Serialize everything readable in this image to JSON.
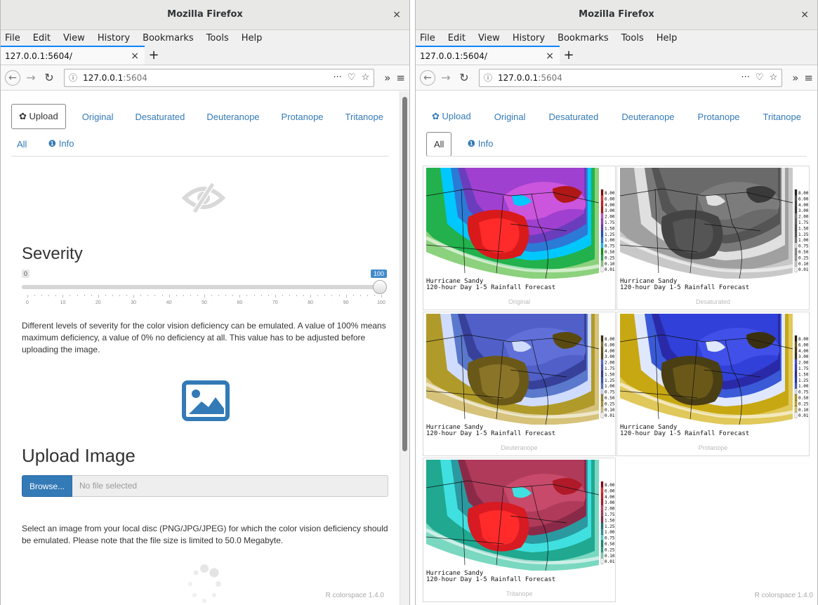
{
  "browser": {
    "window_title": "Mozilla Firefox",
    "close_glyph": "×",
    "menu": [
      "File",
      "Edit",
      "View",
      "History",
      "Bookmarks",
      "Tools",
      "Help"
    ],
    "tab_title": "127.0.0.1:5604/",
    "url_host": "127.0.0.1",
    "url_port": ":5604",
    "url_info_glyph": "ⓘ",
    "url_actions": [
      "···",
      "♡",
      "☆"
    ],
    "overflow_glyph": "»",
    "hamburger_glyph": "≡"
  },
  "app": {
    "nav": [
      {
        "label": "Upload",
        "icon": "gear-icon"
      },
      {
        "label": "Original"
      },
      {
        "label": "Desaturated"
      },
      {
        "label": "Deuteranope"
      },
      {
        "label": "Protanope"
      },
      {
        "label": "Tritanope"
      },
      {
        "label": "All"
      },
      {
        "label": "Info",
        "icon": "info-icon"
      }
    ],
    "footer": "R colorspace 1.4.0"
  },
  "left": {
    "active_tab": "Upload",
    "severity_title": "Severity",
    "slider": {
      "min": 0,
      "max": 100,
      "value": 100,
      "min_label": "0",
      "max_label": "100",
      "tick_labels": [
        "0",
        "10",
        "20",
        "30",
        "40",
        "50",
        "60",
        "70",
        "80",
        "90",
        "100"
      ]
    },
    "severity_text": "Different levels of severity for the color vision deficiency can be emulated. A value of 100% means maximum deficiency, a value of 0% no deficiency at all. This value has to be adjusted before uploading the image.",
    "upload_title": "Upload Image",
    "browse_label": "Browse...",
    "file_placeholder": "No file selected",
    "upload_text": "Select an image from your local disc (PNG/JPG/JPEG) for which the color vision deficiency should be emulated. Please note that the file size is limited to 50.0 Megabyte."
  },
  "right": {
    "active_tab": "All",
    "caption_line1": "Hurricane Sandy",
    "caption_line2": "120-hour Day 1-5 Rainfall Forecast",
    "legend_values": [
      "8.00",
      "6.00",
      "4.00",
      "3.00",
      "2.00",
      "1.75",
      "1.50",
      "1.25",
      "1.00",
      "0.75",
      "0.50",
      "0.25",
      "0.10",
      "0.01"
    ],
    "panels": [
      {
        "label": "Original",
        "colors": [
          "#ffffff",
          "#8cd17d",
          "#22b14c",
          "#00a000",
          "#00c8ff",
          "#2b7bd6",
          "#1e50c8",
          "#6a3dbd",
          "#a040d0",
          "#cc55dd",
          "#b01818",
          "#d81a1a",
          "#ff2a2a",
          "#8b0000"
        ]
      },
      {
        "label": "Desaturated",
        "colors": [
          "#ffffff",
          "#c8c8c8",
          "#a0a0a0",
          "#8e8e8e",
          "#e0e0e0",
          "#7a7a7a",
          "#5c5c5c",
          "#545454",
          "#6a6a6a",
          "#7c7c7c",
          "#3a3a3a",
          "#444444",
          "#555555",
          "#222222"
        ]
      },
      {
        "label": "Deuteranope",
        "colors": [
          "#ffffff",
          "#d6c27a",
          "#b09a2a",
          "#9b8a22",
          "#d0dcff",
          "#5a78cc",
          "#3a5ab8",
          "#37419a",
          "#5060c8",
          "#6070d8",
          "#5a4a10",
          "#6a5818",
          "#8a7428",
          "#3a2e06"
        ]
      },
      {
        "label": "Protanope",
        "colors": [
          "#ffffff",
          "#e0c85a",
          "#c8a812",
          "#b89a10",
          "#e0e8ff",
          "#3a5ad8",
          "#1c3ad0",
          "#2a2aa8",
          "#3040d8",
          "#4050e8",
          "#3a3010",
          "#4a3e14",
          "#6a5818",
          "#201a06"
        ]
      },
      {
        "label": "Tritanope",
        "colors": [
          "#ffffff",
          "#7ad8c0",
          "#20a890",
          "#109078",
          "#40e0e0",
          "#2a9aa0",
          "#1a7880",
          "#8a2a48",
          "#b03a5a",
          "#c84a6a",
          "#b01a28",
          "#d81a22",
          "#ff2a2a",
          "#8b0010"
        ]
      }
    ]
  }
}
